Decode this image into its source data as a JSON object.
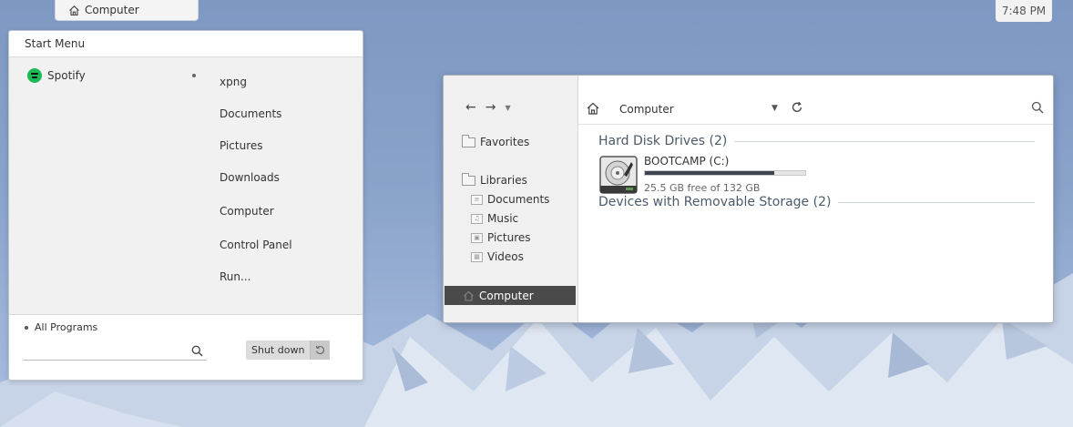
{
  "taskbar": {
    "tab_label": "Computer",
    "clock": "7:48 PM"
  },
  "start_menu": {
    "title": "Start Menu",
    "pinned": [
      {
        "label": "Spotify",
        "icon": "spotify-icon"
      }
    ],
    "links": [
      "xpng",
      "Documents",
      "Pictures",
      "Downloads",
      "Computer",
      "Control Panel",
      "Run..."
    ],
    "all_programs": "All Programs",
    "search_placeholder": "",
    "shutdown_label": "Shut down"
  },
  "explorer": {
    "address": "Computer",
    "nav": {
      "favorites": "Favorites",
      "libraries": "Libraries",
      "library_items": [
        "Documents",
        "Music",
        "Pictures",
        "Videos"
      ],
      "computer": "Computer"
    },
    "groups": [
      {
        "title": "Hard Disk Drives (2)"
      },
      {
        "title": "Devices with Removable Storage (2)"
      }
    ],
    "drive": {
      "name": "BOOTCAMP (C:)",
      "free_text": "25.5 GB free of 132 GB",
      "used_fraction": 0.807
    }
  },
  "colors": {
    "selected_nav": "#4a4a4a",
    "spotify": "#1db954",
    "drive_fill": "#3d4650"
  }
}
